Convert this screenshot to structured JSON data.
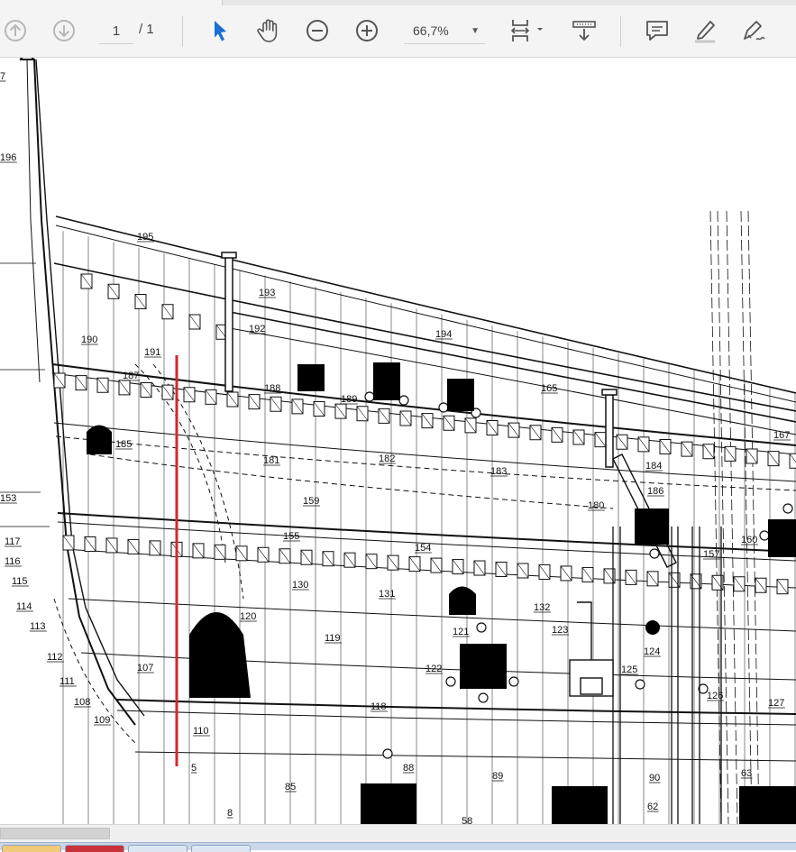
{
  "toolbar": {
    "current_page": "1",
    "total_pages": "/ 1",
    "zoom_value": "66,7%",
    "icons": {
      "prev_page": "page-up-icon",
      "next_page": "page-down-icon",
      "select": "pointer-icon",
      "hand": "hand-icon",
      "zoom_out": "zoom-out-icon",
      "zoom_in": "zoom-in-icon",
      "fit": "fit-page-icon",
      "scroll_mode": "scroll-mode-icon",
      "comment": "comment-icon",
      "highlight": "highlight-pen-icon",
      "sign": "sign-pen-icon"
    },
    "active_color": "#1a6fd4"
  },
  "drawing": {
    "labels": [
      "7",
      "196",
      "195",
      "193",
      "192",
      "194",
      "190",
      "191",
      "187",
      "188",
      "189",
      "165",
      "167",
      "185",
      "181",
      "182",
      "183",
      "184",
      "186",
      "153",
      "159",
      "180",
      "117",
      "116",
      "155",
      "154",
      "157",
      "160",
      "115",
      "130",
      "131",
      "132",
      "114",
      "120",
      "113",
      "119",
      "121",
      "123",
      "124",
      "112",
      "107",
      "122",
      "125",
      "111",
      "118",
      "126",
      "127",
      "108",
      "109",
      "110",
      "88",
      "89",
      "90",
      "63",
      "85",
      "62",
      "58",
      "8",
      "5"
    ],
    "overlay_color": "#d9262b"
  }
}
